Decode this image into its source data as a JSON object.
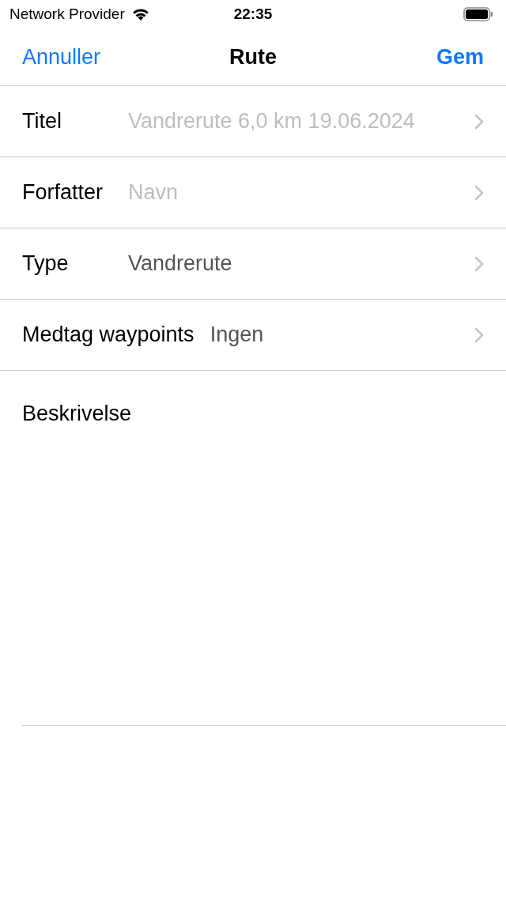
{
  "status_bar": {
    "carrier": "Network Provider",
    "time": "22:35"
  },
  "nav": {
    "cancel": "Annuller",
    "title": "Rute",
    "save": "Gem"
  },
  "fields": [
    {
      "label": "Titel",
      "placeholder": "Vandrerute 6,0 km 19.06.2024"
    },
    {
      "label": "Forfatter",
      "placeholder": "Navn"
    },
    {
      "label": "Type",
      "value": "Vandrerute"
    },
    {
      "label": "Medtag waypoints",
      "value": "Ingen"
    }
  ],
  "description": {
    "label": "Beskrivelse"
  }
}
